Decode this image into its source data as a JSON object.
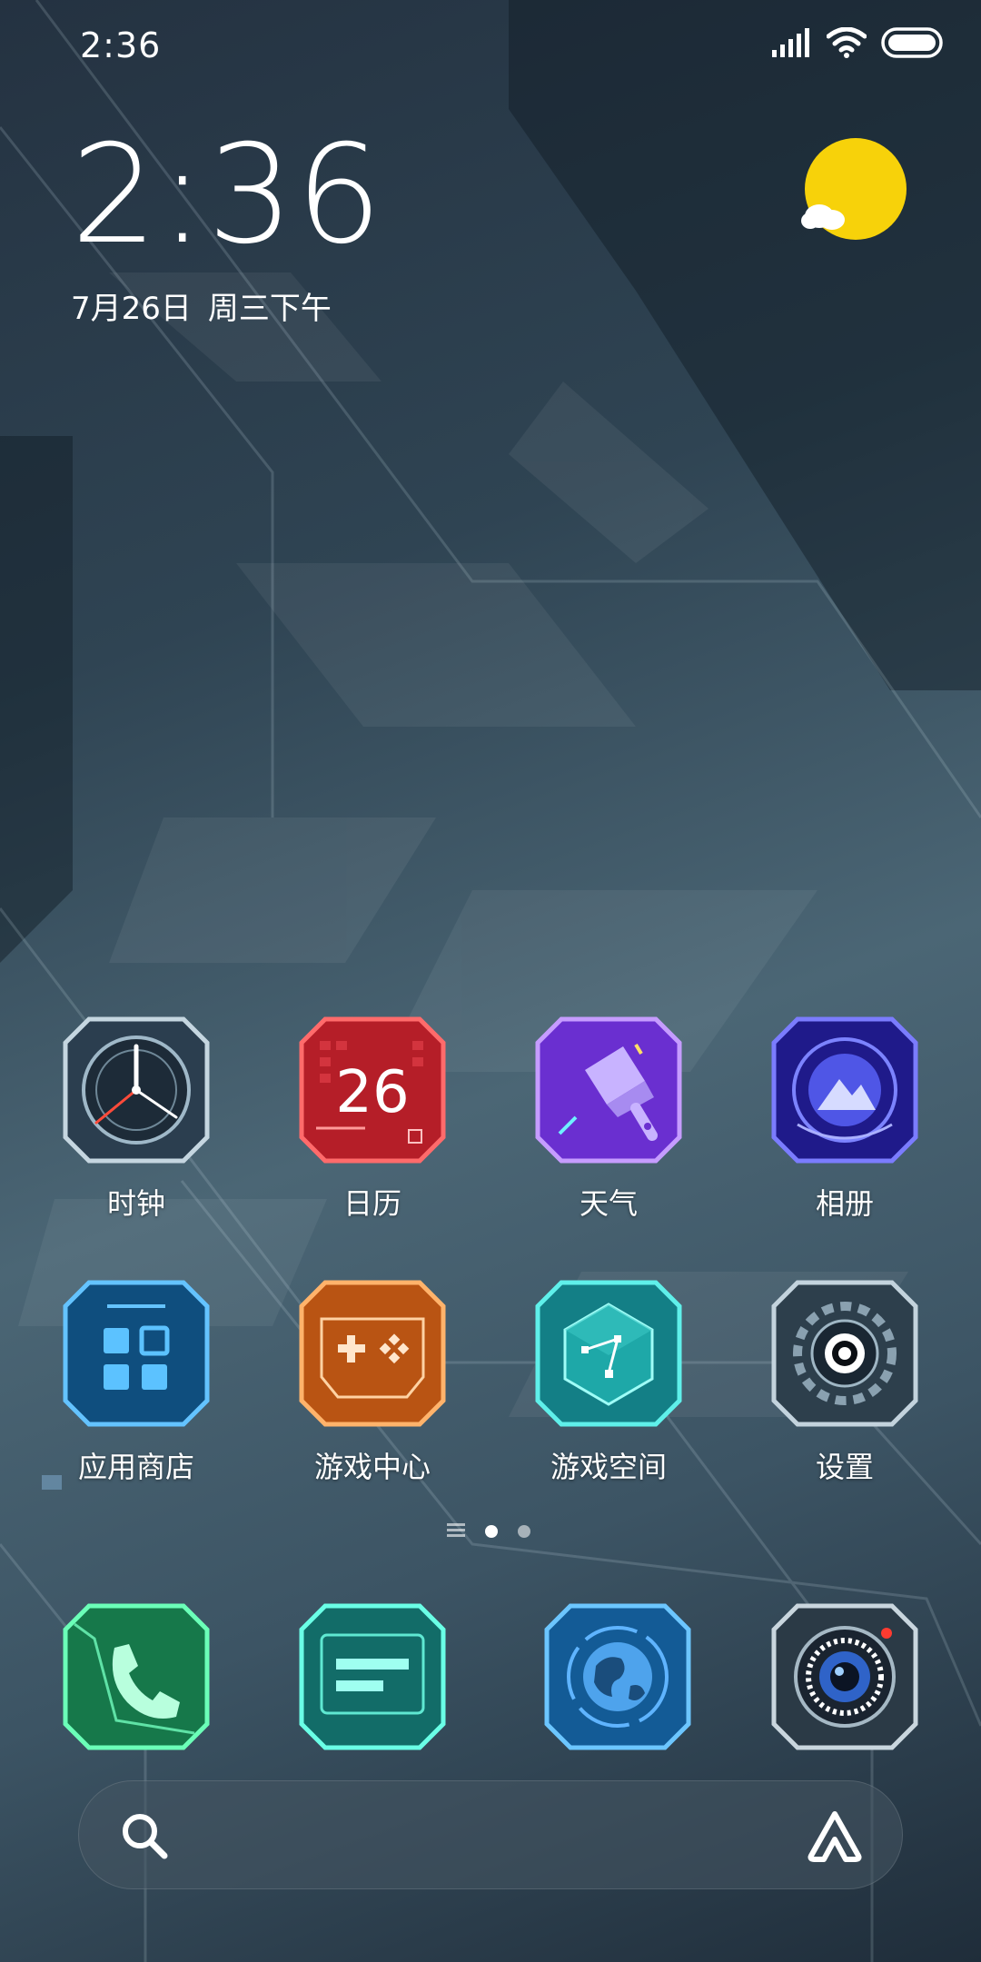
{
  "status_bar": {
    "time": "2:36"
  },
  "clock_widget": {
    "time": "2:36",
    "date": "7月26日",
    "weekday_period": "周三下午"
  },
  "apps": [
    {
      "label": "时钟",
      "icon": "clock-icon"
    },
    {
      "label": "日历",
      "icon": "calendar-icon",
      "badge_text": "26"
    },
    {
      "label": "天气",
      "icon": "weather-brush-icon"
    },
    {
      "label": "相册",
      "icon": "gallery-icon"
    },
    {
      "label": "应用商店",
      "icon": "app-store-icon"
    },
    {
      "label": "游戏中心",
      "icon": "game-center-icon"
    },
    {
      "label": "游戏空间",
      "icon": "game-space-icon"
    },
    {
      "label": "设置",
      "icon": "settings-gear-icon"
    }
  ],
  "dock": [
    {
      "icon": "phone-icon"
    },
    {
      "icon": "messages-icon"
    },
    {
      "icon": "browser-globe-icon"
    },
    {
      "icon": "camera-icon"
    }
  ],
  "page_indicator": {
    "pages": 2,
    "active_index": 0
  },
  "colors": {
    "weather_sun": "#f7d20a",
    "calendar": "#d4252f",
    "weather_app": "#7b3fe0",
    "gallery": "#3a30c8",
    "app_store": "#1a6ea8",
    "game_center": "#d1651a",
    "game_space": "#21a9a6",
    "phone": "#1f9a5e",
    "messages": "#1c8c86",
    "browser": "#1f73b8"
  }
}
